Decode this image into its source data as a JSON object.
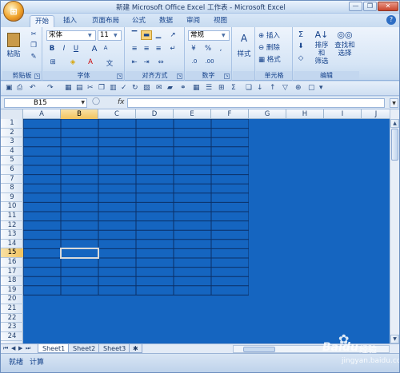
{
  "app": {
    "title": "新建 Microsoft Office Excel 工作表 - Microsoft Excel",
    "office_button_glyph": "⊞"
  },
  "window_controls": {
    "minimize": "—",
    "restore": "❐",
    "close": "✕"
  },
  "ribbon_tabs": [
    "开始",
    "插入",
    "页面布局",
    "公式",
    "数据",
    "审阅",
    "视图"
  ],
  "ribbon": {
    "clipboard": {
      "label": "剪贴板",
      "paste": "粘贴"
    },
    "font": {
      "label": "字体",
      "name": "宋体",
      "size": "11",
      "bold": "B",
      "italic": "I",
      "underline": "U",
      "grow": "A",
      "shrink": "A"
    },
    "alignment": {
      "label": "对齐方式"
    },
    "number": {
      "label": "数字",
      "format": "常规",
      "percent": "%",
      "comma": ","
    },
    "styles": {
      "label": "样式",
      "button": "样式"
    },
    "cells": {
      "label": "单元格",
      "insert": "插入",
      "delete": "删除",
      "format": "格式"
    },
    "editing": {
      "label": "编辑",
      "sort": "排序和\n筛选",
      "find": "查找和\n选择"
    }
  },
  "formula_bar": {
    "name_box": "B15",
    "fx": "fx",
    "value": ""
  },
  "columns": [
    "A",
    "B",
    "C",
    "D",
    "E",
    "F",
    "G",
    "H",
    "I",
    "J"
  ],
  "rows": [
    "1",
    "2",
    "3",
    "4",
    "5",
    "6",
    "7",
    "8",
    "9",
    "10",
    "11",
    "12",
    "13",
    "14",
    "15",
    "16",
    "17",
    "18",
    "19",
    "20",
    "21",
    "22",
    "23",
    "24"
  ],
  "selected_cell": {
    "column": "B",
    "row": "15"
  },
  "sheet_tabs": [
    "Sheet1",
    "Sheet2",
    "Sheet3"
  ],
  "status": {
    "left": "就绪",
    "mode": "计算"
  },
  "watermark": {
    "brand": "Baidu",
    "suffix": "经验",
    "url": "jingyan.baidu.com"
  },
  "colors": {
    "sheet_fill": "#1565c0",
    "grid_line": "#0b2f66"
  }
}
